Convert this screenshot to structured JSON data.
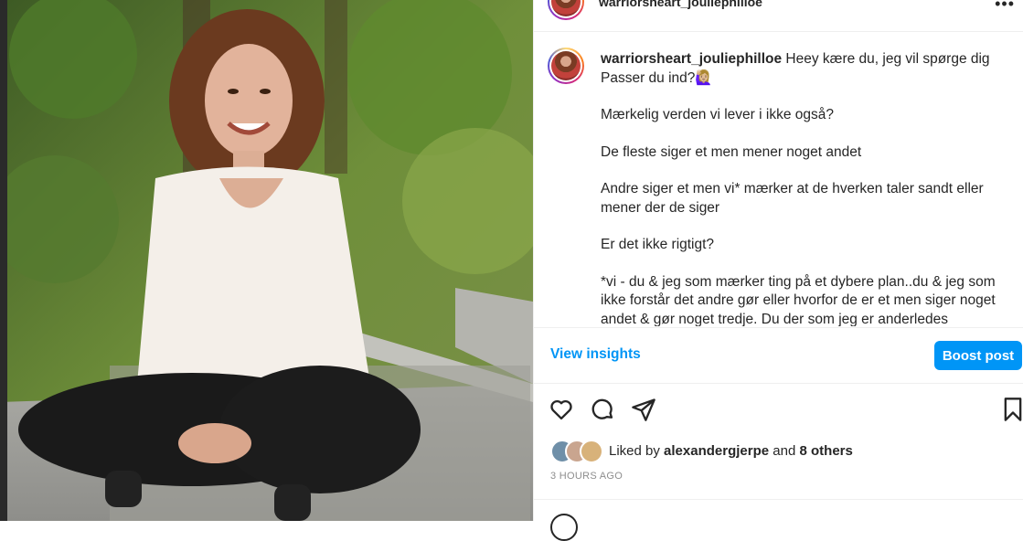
{
  "post": {
    "username": "warriorsheart_jouliephilloe",
    "more_label": "•••",
    "caption": {
      "username": "warriorsheart_jouliephilloe",
      "line1": "Heey kære du, jeg vil spørge dig Passer du ind?🙋🏼‍♀️",
      "line2": "Mærkelig verden vi lever i ikke også?",
      "line3": "De fleste siger et men mener noget andet",
      "line4": "Andre siger et men vi* mærker at de hverken taler sandt eller mener der de siger",
      "line5": "Er det ikke rigtigt?",
      "line6": "*vi - du & jeg som mærker ting på et dybere plan..du & jeg som ikke forstår det andre gør eller hvorfor de er et men siger noget andet & gør noget tredje. Du der som jeg er anderledes"
    },
    "insights_label": "View insights",
    "boost_label": "Boost post",
    "likes": {
      "prefix": "Liked by",
      "user": "alexandergjerpe",
      "and": "and",
      "others": "8 others"
    },
    "timestamp": "3 HOURS AGO"
  },
  "icons": {
    "like": "heart-icon",
    "comment": "comment-icon",
    "share": "share-icon",
    "save": "bookmark-icon"
  },
  "colors": {
    "accent": "#0095f6",
    "text": "#262626",
    "muted": "#8e8e8e"
  }
}
